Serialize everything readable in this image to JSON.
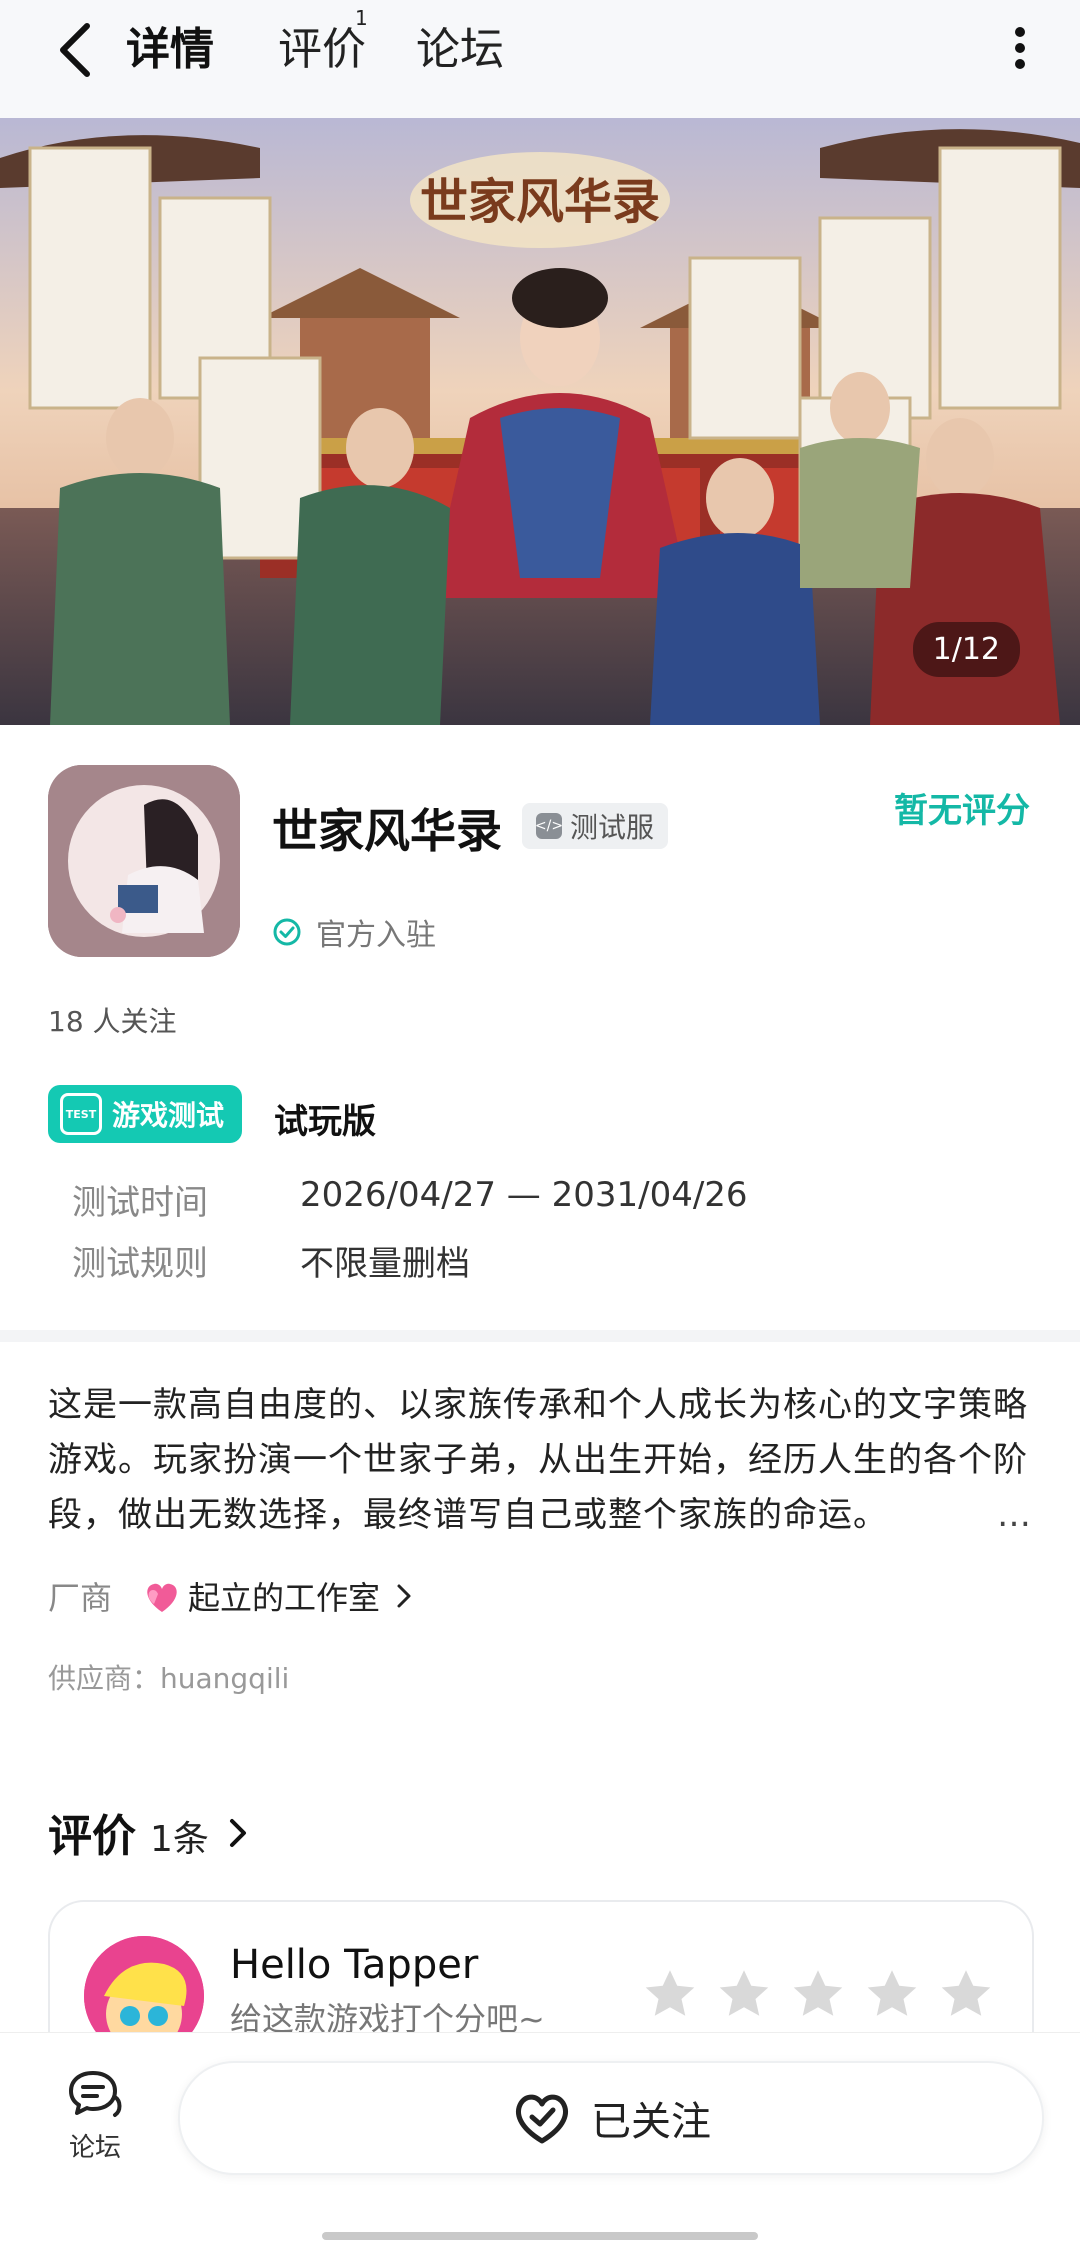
{
  "header": {
    "tabs": [
      {
        "label": "详情"
      },
      {
        "label": "评价"
      },
      {
        "label": "论坛"
      }
    ],
    "review_badge": "1"
  },
  "banner": {
    "title": "世家风华录",
    "counter": "1/12"
  },
  "app": {
    "name": "世家风华录",
    "badge": "测试服",
    "official": "官方入驻",
    "rating": "暂无评分",
    "followers": "18 人关注"
  },
  "test": {
    "tag": "游戏测试",
    "tag_icon_text": "TEST",
    "version": "试玩版",
    "rows": [
      {
        "label": "测试时间",
        "value": "2026/04/27 — 2031/04/26"
      },
      {
        "label": "测试规则",
        "value": "不限量删档"
      }
    ]
  },
  "description": {
    "text": "这是一款高自由度的、以家族传承和个人成长为核心的文字策略游戏。玩家扮演一个世家子弟，从出生开始，经历人生的各个阶段，做出无数选择，最终谱写自己或整个家族的命运。",
    "more": "…"
  },
  "vendor": {
    "label": "厂商",
    "name": "起立的工作室",
    "supplier": "供应商：huangqili"
  },
  "reviews": {
    "heading": "评价",
    "count": "1条",
    "user_name": "Hello Tapper",
    "prompt": "给这款游戏打个分吧~",
    "stars": [
      0,
      0,
      0,
      0,
      0
    ]
  },
  "bottom": {
    "forum_label": "论坛",
    "follow_label": "已关注"
  },
  "colors": {
    "accent": "#14c9b3",
    "rating": "#14b8a6",
    "star_empty": "#d9d9d9"
  }
}
